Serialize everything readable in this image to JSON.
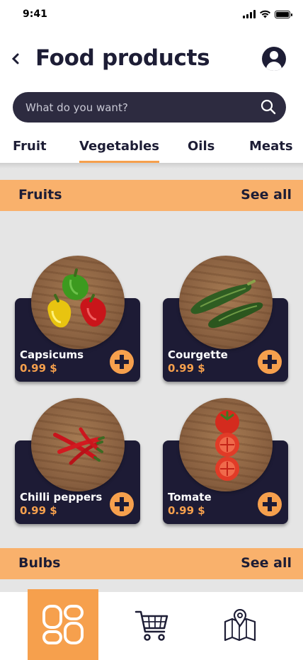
{
  "status_bar": {
    "time": "9:41"
  },
  "header": {
    "title": "Food products",
    "back_icon": "chevron-left-icon",
    "account_icon": "user-circle-icon"
  },
  "search": {
    "placeholder": "What do you want?",
    "icon": "search-icon"
  },
  "tabs": [
    {
      "label": "Fruit",
      "active": false
    },
    {
      "label": "Vegetables",
      "active": true
    },
    {
      "label": "Oils",
      "active": false
    },
    {
      "label": "Meats",
      "active": false
    }
  ],
  "sections": [
    {
      "title": "Fruits",
      "see_all": "See all",
      "products": [
        {
          "name": "Capsicums",
          "price": "0.99 $"
        },
        {
          "name": "Courgette",
          "price": "0.99 $"
        },
        {
          "name": "Chilli peppers",
          "price": "0.99 $"
        },
        {
          "name": "Tomate",
          "price": "0.99 $"
        }
      ]
    },
    {
      "title": "Bulbs",
      "see_all": "See all",
      "products": []
    }
  ],
  "bottom_nav": [
    {
      "icon": "grid-home-icon",
      "active": true
    },
    {
      "icon": "shopping-cart-icon",
      "active": false
    },
    {
      "icon": "map-pin-icon",
      "active": false
    }
  ],
  "colors": {
    "accent": "#f6a04d",
    "section_bar": "#f9b16c",
    "dark": "#1d1b35",
    "search_bg": "#2d2b40",
    "content_bg": "#e5e5e5"
  }
}
